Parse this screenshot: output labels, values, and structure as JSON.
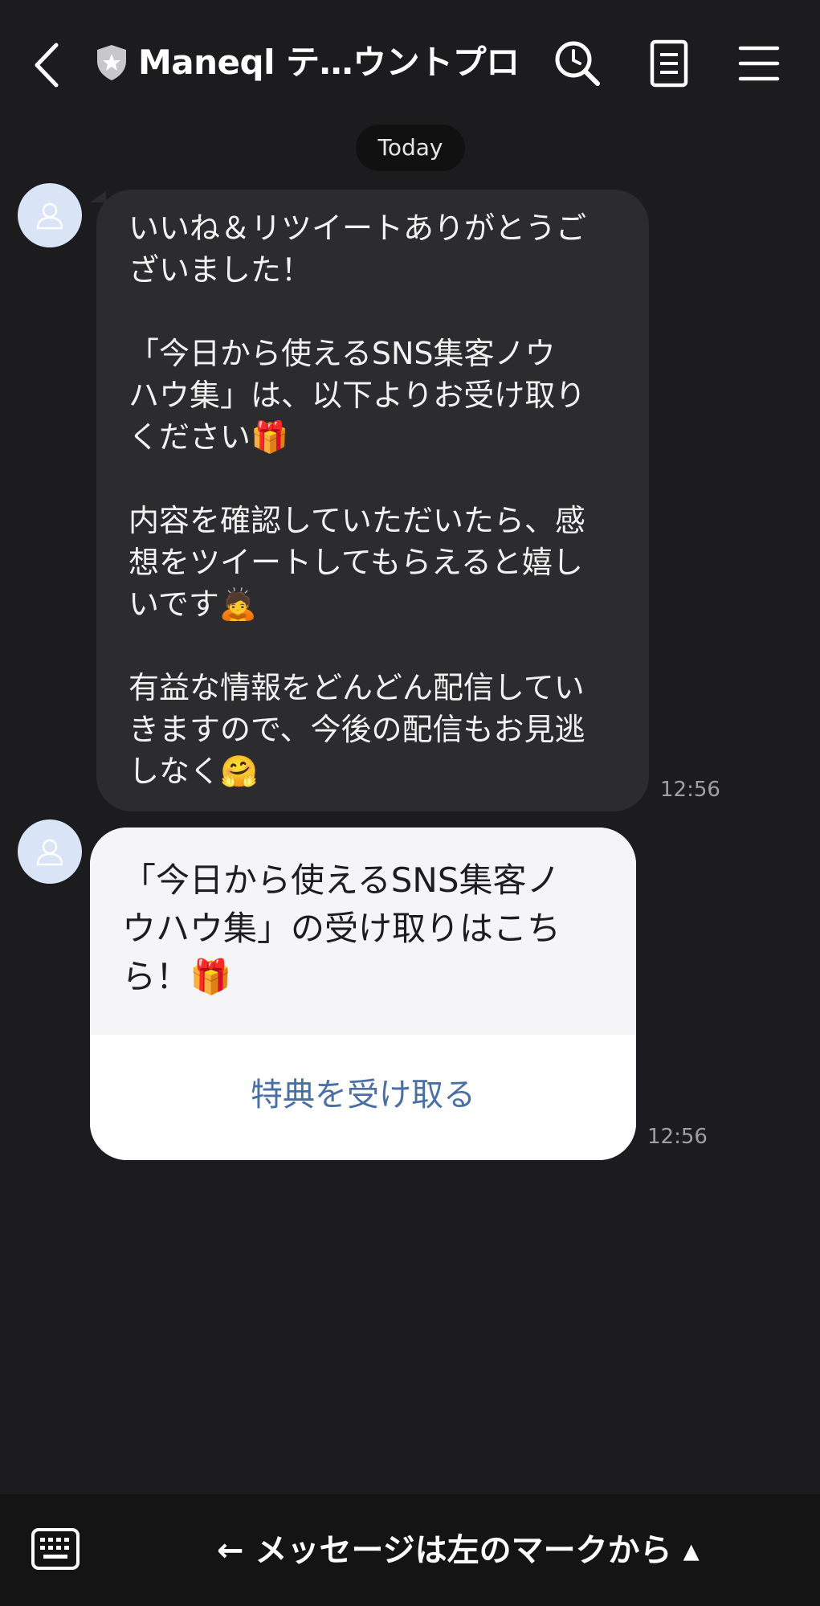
{
  "header": {
    "title": "Maneql テ…ウントプロ",
    "icons": [
      "back-icon",
      "shield-icon",
      "search-icon",
      "notes-icon",
      "menu-icon"
    ]
  },
  "date_label": "Today",
  "message1": {
    "lines": [
      "いいね＆リツイートありがとうご",
      "ざいました！",
      "",
      "「今日から使えるSNS集客ノウ",
      "ハウ集」は、以下よりお受け取り",
      "ください🎁",
      "",
      "内容を確認していただいたら、感",
      "想をツイートしてもらえると嬉し",
      "いです🙇",
      "",
      "有益な情報をどんどん配信してい",
      "きますので、今後の配信もお見逃",
      "しなく🤗"
    ],
    "time": "12:56"
  },
  "message2": {
    "lines": [
      "「今日から使えるSNS集客ノ",
      "ウハウ集」の受け取りはこち",
      "ら！🎁"
    ],
    "button_label": "特典を受け取る",
    "time": "12:56"
  },
  "footer": {
    "prompt": "← メッセージは左のマークから ▴"
  },
  "colors": {
    "background": "#1c1c1e",
    "bubble": "#2c2c2e",
    "avatar": "#d9e4f7",
    "link": "#4a6fa5"
  }
}
